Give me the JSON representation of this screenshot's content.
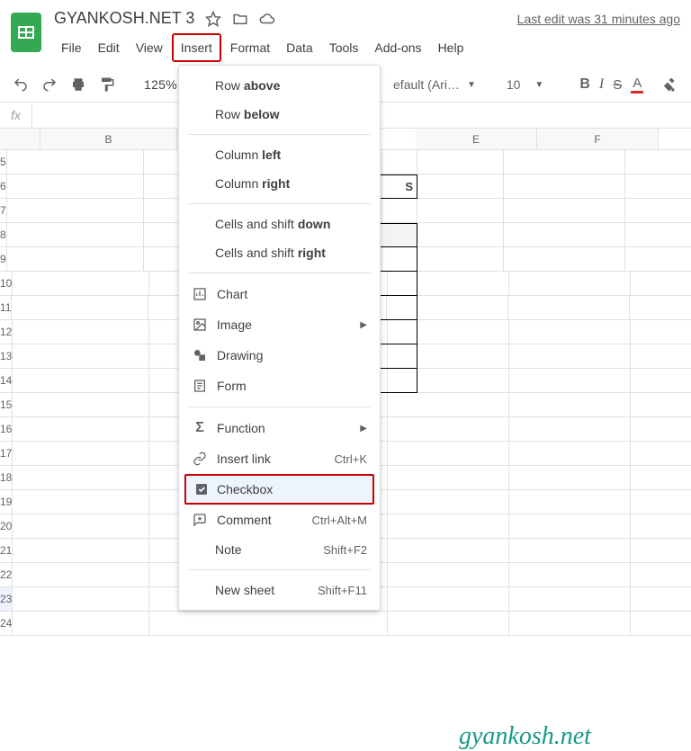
{
  "doc": {
    "title": "GYANKOSH.NET 3"
  },
  "header": {
    "last_edit": "Last edit was 31 minutes ago"
  },
  "menus": {
    "file": "File",
    "edit": "Edit",
    "view": "View",
    "insert": "Insert",
    "format": "Format",
    "data": "Data",
    "tools": "Tools",
    "addons": "Add-ons",
    "help": "Help"
  },
  "toolbar": {
    "zoom": "125%",
    "font": "efault (Ari…",
    "size": "10"
  },
  "dropdown": {
    "row_above_pre": "Row ",
    "row_above_b": "above",
    "row_below_pre": "Row ",
    "row_below_b": "below",
    "col_left_pre": "Column ",
    "col_left_b": "left",
    "col_right_pre": "Column ",
    "col_right_b": "right",
    "cells_down_pre": "Cells and shift ",
    "cells_down_b": "down",
    "cells_right_pre": "Cells and shift ",
    "cells_right_b": "right",
    "chart": "Chart",
    "image": "Image",
    "drawing": "Drawing",
    "form": "Form",
    "function": "Function",
    "link": "Insert link",
    "link_sc": "Ctrl+K",
    "checkbox": "Checkbox",
    "comment": "Comment",
    "comment_sc": "Ctrl+Alt+M",
    "note": "Note",
    "note_sc": "Shift+F2",
    "new_sheet": "New sheet",
    "new_sheet_sc": "Shift+F11"
  },
  "columns": [
    "B",
    "E",
    "F"
  ],
  "rows": [
    5,
    6,
    7,
    8,
    9,
    10,
    11,
    12,
    13,
    14,
    15,
    16,
    17,
    18,
    19,
    20,
    21,
    22,
    23,
    24
  ],
  "selected_row": 23,
  "watermark": "gyankosh.net"
}
